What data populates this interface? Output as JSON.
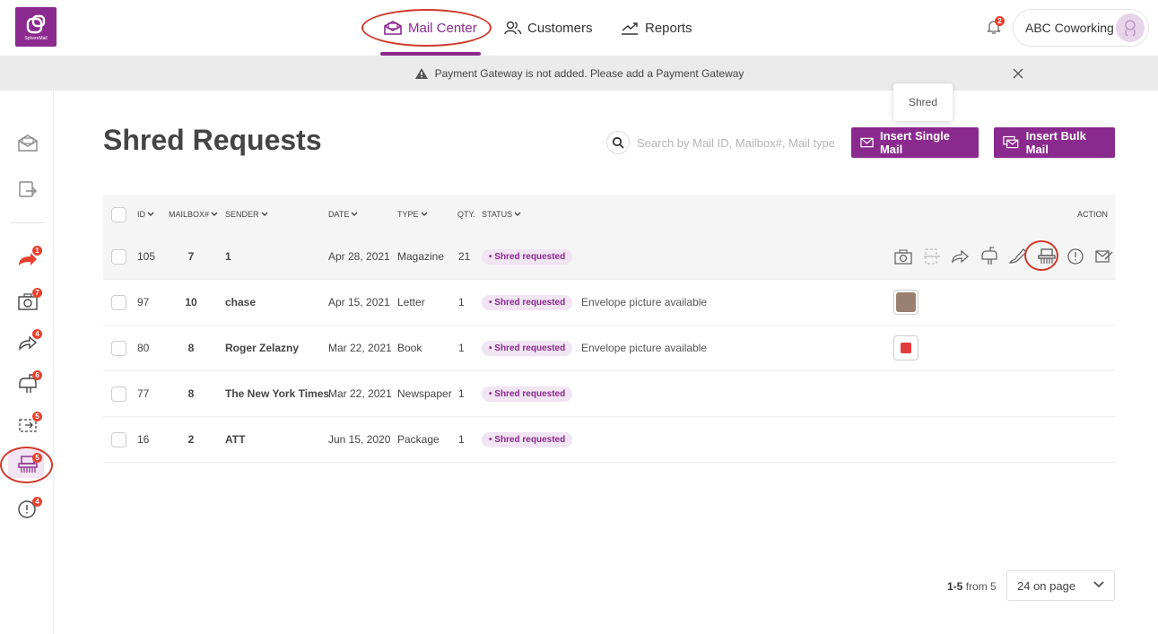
{
  "app": {
    "logo_text": "SphereMail"
  },
  "nav": {
    "mail_center": "Mail Center",
    "customers": "Customers",
    "reports": "Reports"
  },
  "notifications": {
    "count": "2"
  },
  "account": {
    "name": "ABC Coworking"
  },
  "banner": {
    "message": "Payment Gateway is not added. Please add a  Payment Gateway"
  },
  "sidebar": {
    "items": [
      {
        "icon": "inbox-mail-icon",
        "badge": ""
      },
      {
        "icon": "outgoing-mail-icon",
        "badge": ""
      },
      {
        "icon": "urgent-forward-icon",
        "badge": "1"
      },
      {
        "icon": "camera-icon",
        "badge": "7"
      },
      {
        "icon": "forward-icon",
        "badge": "4"
      },
      {
        "icon": "mailbox-icon",
        "badge": "6"
      },
      {
        "icon": "scan-icon",
        "badge": "5"
      },
      {
        "icon": "shred-icon",
        "badge": "5"
      },
      {
        "icon": "alert-icon",
        "badge": "4"
      }
    ]
  },
  "page": {
    "title": "Shred Requests",
    "search_placeholder": "Search by Mail ID, Mailbox#, Mail type",
    "insert_single": "Insert Single Mail",
    "insert_bulk": "Insert Bulk Mail"
  },
  "table": {
    "headers": {
      "id": "ID",
      "mailbox": "MAILBOX#",
      "sender": "SENDER",
      "date": "DATE",
      "type": "TYPE",
      "qty": "QTY.",
      "status": "STATUS",
      "action": "ACTION"
    },
    "rows": [
      {
        "id": "105",
        "mailbox": "7",
        "sender": "1",
        "date": "Apr 28, 2021",
        "type": "Magazine",
        "qty": "21",
        "status": "• Shred requested",
        "note": ""
      },
      {
        "id": "97",
        "mailbox": "10",
        "sender": "chase",
        "date": "Apr 15, 2021",
        "type": "Letter",
        "qty": "1",
        "status": "• Shred requested",
        "note": "Envelope picture available"
      },
      {
        "id": "80",
        "mailbox": "8",
        "sender": "Roger Zelazny",
        "date": "Mar 22, 2021",
        "type": "Book",
        "qty": "1",
        "status": "• Shred requested",
        "note": "Envelope picture available"
      },
      {
        "id": "77",
        "mailbox": "8",
        "sender": "The New York Times",
        "date": "Mar 22, 2021",
        "type": "Newspaper",
        "qty": "1",
        "status": "• Shred requested",
        "note": ""
      },
      {
        "id": "16",
        "mailbox": "2",
        "sender": "ATT",
        "date": "Jun 15, 2020",
        "type": "Package",
        "qty": "1",
        "status": "• Shred requested",
        "note": ""
      }
    ]
  },
  "tooltip": {
    "text": "Shred"
  },
  "pagination": {
    "range": "1-5",
    "from_label": "from 5",
    "page_size": "24 on page"
  },
  "colors": {
    "brand": "#8a2a8e",
    "badge": "#e8412f",
    "highlight": "#d0392b"
  }
}
